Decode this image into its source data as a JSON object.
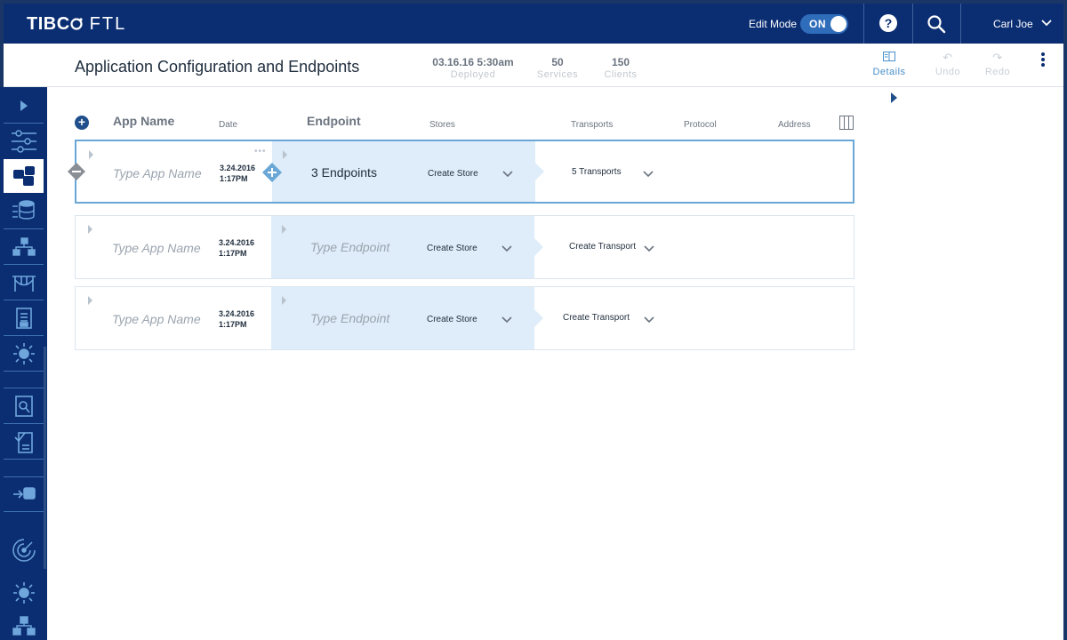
{
  "topbar": {
    "logo_main": "TIBC",
    "logo_sub": "FTL",
    "edit_mode_label": "Edit Mode",
    "toggle_label": "ON",
    "help_glyph": "?",
    "user_name": "Carl Joe"
  },
  "subheader": {
    "title": "Application Configuration and Endpoints",
    "stats": [
      {
        "value": "03.16.16 5:30am",
        "label": "Deployed"
      },
      {
        "value": "50",
        "label": "Services"
      },
      {
        "value": "150",
        "label": "Clients"
      }
    ],
    "actions": [
      {
        "label": "Details",
        "icon": "details-icon",
        "state": "active"
      },
      {
        "label": "Undo",
        "icon": "undo-icon",
        "state": "disabled"
      },
      {
        "label": "Redo",
        "icon": "redo-icon",
        "state": "disabled"
      }
    ]
  },
  "columns": {
    "app_name": "App Name",
    "date": "Date",
    "endpoint": "Endpoint",
    "stores": "Stores",
    "transports": "Transports",
    "protocol": "Protocol",
    "address": "Address"
  },
  "rows": [
    {
      "app_placeholder": "Type App Name",
      "date": "3.24.2016",
      "time": "1:17PM",
      "endpoint": "3 Endpoints",
      "store": "Create Store",
      "transport": "5 Transports",
      "selected": true
    },
    {
      "app_placeholder": "Type App Name",
      "date": "3.24.2016",
      "time": "1:17PM",
      "endpoint": "Type Endpoint",
      "store": "Create Store",
      "transport": "Create Transport",
      "selected": false
    },
    {
      "app_placeholder": "Type App Name",
      "date": "3.24.2016",
      "time": "1:17PM",
      "endpoint": "Type Endpoint",
      "store": "Create Store",
      "transport": "Create Transport",
      "selected": false
    }
  ],
  "sidebar_icons": [
    "expand-icon",
    "sliders-icon",
    "apps-icon",
    "database-icon",
    "hierarchy-icon",
    "bridge-icon",
    "document-icon",
    "sun-icon",
    "search-document-icon",
    "checklist-icon",
    "import-icon",
    "radar-icon",
    "sun-icon",
    "flow-icon"
  ],
  "colors": {
    "primary": "#0b2e73",
    "accent": "#4a8fc8",
    "endpoint_bg": "#deedf9"
  }
}
